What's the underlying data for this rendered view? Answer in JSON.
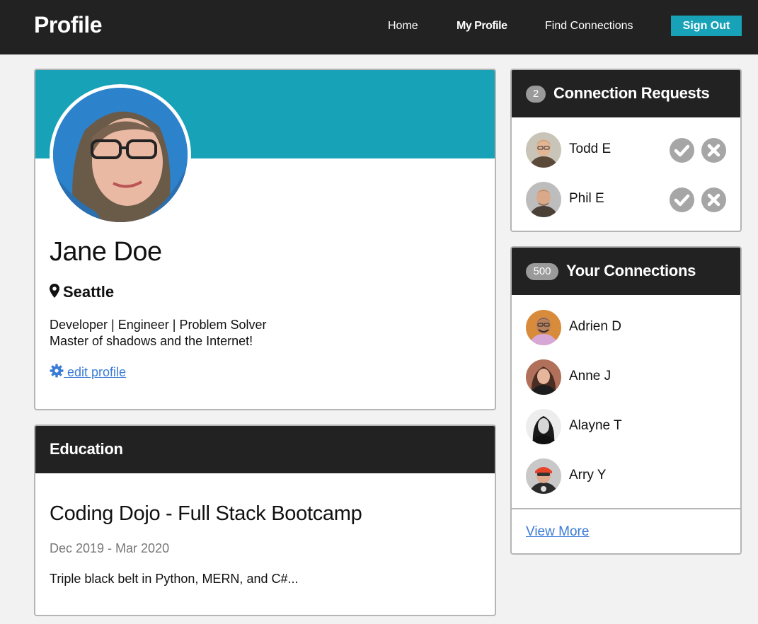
{
  "colors": {
    "nav_bg": "#222222",
    "accent": "#17a2b8",
    "link": "#3a7bd5",
    "badge": "#9a9a9a",
    "action_gray": "#a6a6a6"
  },
  "navbar": {
    "brand": "Profile",
    "links": {
      "home": "Home",
      "my_profile": "My Profile",
      "find": "Find Connections"
    },
    "sign_out": "Sign Out"
  },
  "profile": {
    "name": "Jane Doe",
    "location": "Seattle",
    "location_icon": "map-pin-icon",
    "bio_line1": "Developer | Engineer | Problem Solver",
    "bio_line2": "Master of shadows and the Internet!",
    "edit_icon": "gear-icon",
    "edit_label": " edit profile"
  },
  "education": {
    "header": "Education",
    "school": "Coding Dojo - Full Stack Bootcamp",
    "dates": "Dec 2019 - Mar 2020",
    "description": "Triple black belt in Python, MERN, and C#..."
  },
  "requests": {
    "count": "2",
    "title": "Connection Requests",
    "accept_icon": "check-icon",
    "reject_icon": "close-icon",
    "items": [
      {
        "name": "Todd E"
      },
      {
        "name": "Phil E"
      }
    ]
  },
  "connections": {
    "count": "500",
    "title": "Your Connections",
    "items": [
      {
        "name": "Adrien D"
      },
      {
        "name": "Anne J"
      },
      {
        "name": "Alayne T"
      },
      {
        "name": "Arry Y"
      }
    ],
    "view_more": "View More"
  }
}
